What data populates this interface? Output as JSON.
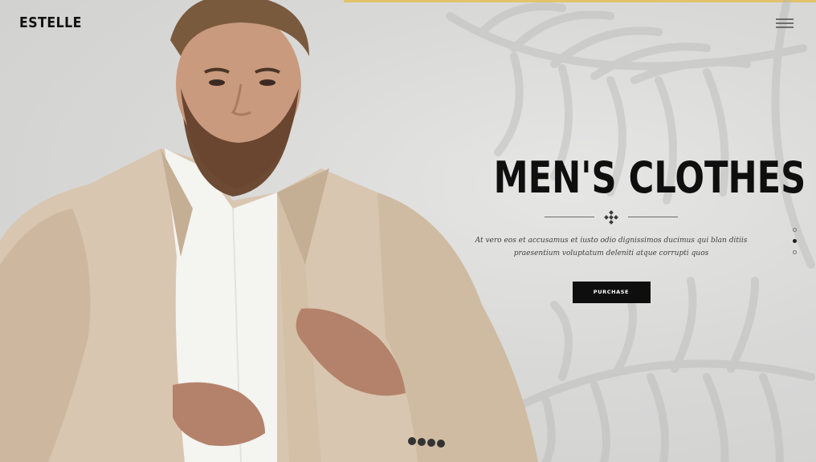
{
  "header": {
    "brand": "ESTELLE",
    "menu_icon": "hamburger-menu-icon"
  },
  "hero": {
    "heading": "MEN'S CLOTHES",
    "divider_icon": "diamond-ornament-icon",
    "description": "At vero eos et accusamus et iusto odio dignissimos ducimus qui blan ditiis praesentium voluptatum deleniti atque corrupti quos",
    "button_label": "PURCHASE",
    "image": "man-in-beige-coat-photo"
  },
  "slider": {
    "slide_count": 3,
    "active_index": 1
  },
  "colors": {
    "accent": "#e2c36a",
    "button": "#0e0e0e",
    "background": "#dcdcdb",
    "heading": "#0f0f0f"
  }
}
